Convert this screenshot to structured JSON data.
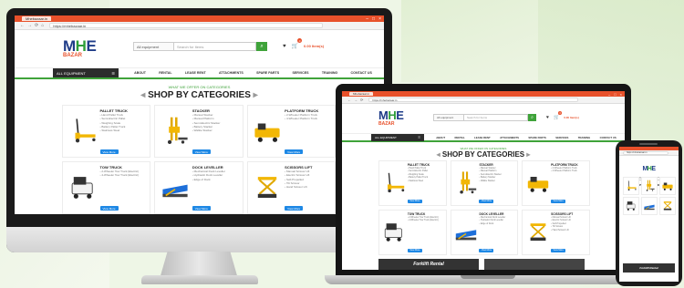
{
  "site": {
    "tab_title": "Mhebazaar.in",
    "url": "https://mhebazaar.in",
    "logo_main": "MHE",
    "logo_sub": "BAZAR",
    "search_category": "All equipment",
    "search_placeholder": "Search for Items",
    "cart_count": "0",
    "cart_total": "0.00 Item(s)",
    "all_categories": "ALL EQUIPMENT",
    "menu": [
      "ABOUT",
      "RENTAL",
      "LEASE RENT",
      "ATTACHMENTS",
      "SPARE PARTS",
      "SERVICES",
      "TRAINING",
      "CONTACT US"
    ],
    "section_kicker": "WHAT WE OFFER ON CATEGORIES",
    "section_title": "SHOP BY CATEGORIES",
    "view_button": "View More",
    "banner_text": "Forklift Rental",
    "colors": {
      "brand_orange": "#e8512b",
      "brand_green": "#3fa33a",
      "brand_blue": "#1f3c88",
      "button_blue": "#1e88e5"
    }
  },
  "categories": [
    {
      "title": "PALLET TRUCK",
      "icon": "pallet-truck-icon",
      "items": [
        "Hand Pallet Truck",
        "Semi-Electric Pallet",
        "Weighing Scale",
        "Battery Pallet Truck",
        "Stainless Steel"
      ]
    },
    {
      "title": "STACKER",
      "icon": "stacker-icon",
      "items": [
        "Manual Stacker",
        "Manual Platform",
        "Semi-Electric Stacker",
        "Battery Stacker",
        "Walkie Stacker"
      ]
    },
    {
      "title": "PLATFORM TRUCK",
      "icon": "platform-truck-icon",
      "items": [
        "2-Wheeler Platform Truck",
        "4-Wheeler Platform Truck"
      ]
    },
    {
      "title": "TOW TRUCK",
      "icon": "tow-truck-icon",
      "items": [
        "2-Wheeler Tow Truck (Electric)",
        "4-Wheeler Tow Truck (Electric)"
      ]
    },
    {
      "title": "DOCK LEVELLER",
      "icon": "dock-leveller-icon",
      "items": [
        "Mechanical Dock Leveller",
        "Hydraulic Dock Leveller",
        "Edge of Dock"
      ]
    },
    {
      "title": "SCISSORS LIFT",
      "icon": "scissors-lift-icon",
      "items": [
        "Manual Scissor Lift",
        "Electric Scissor Lift",
        "Self-Propelled",
        "Tilt Scissor",
        "Hand Scissor Lift"
      ]
    }
  ]
}
